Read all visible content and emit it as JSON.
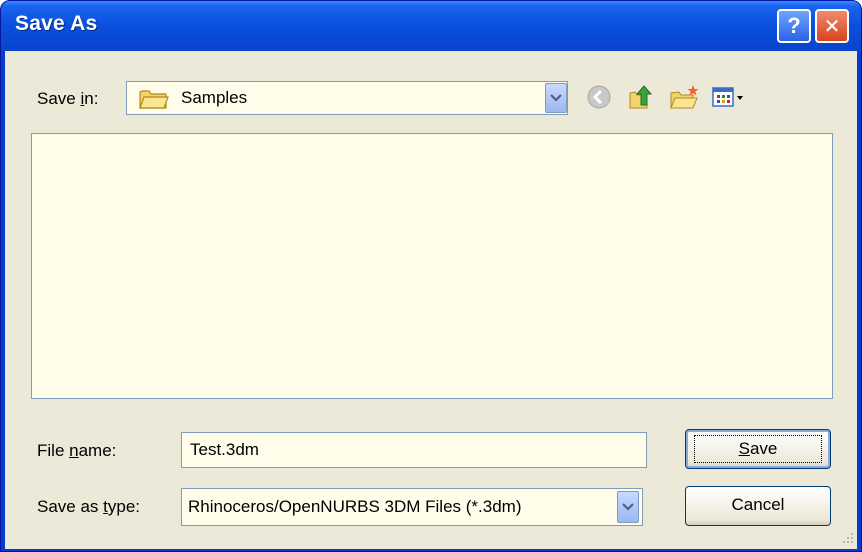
{
  "window": {
    "title": "Save As",
    "help_label": "?",
    "close_label": "✕"
  },
  "save_in": {
    "label_prefix": "Save ",
    "label_access": "i",
    "label_suffix": "n:",
    "value": "Samples"
  },
  "toolbar": {
    "icons": [
      "back-icon",
      "up-folder-icon",
      "new-folder-icon",
      "views-menu-icon"
    ]
  },
  "file_name": {
    "label_prefix": "File ",
    "label_access": "n",
    "label_suffix": "ame:",
    "value": "Test.3dm"
  },
  "save_type": {
    "label_prefix": "Save as ",
    "label_access": "t",
    "label_suffix": "ype:",
    "value": "Rhinoceros/OpenNURBS 3DM Files (*.3dm)"
  },
  "buttons": {
    "save_access": "S",
    "save_rest": "ave",
    "cancel": "Cancel"
  },
  "colors": {
    "titlebar": "#0a50dc",
    "client": "#ece9d8",
    "field_bg": "#fffdea",
    "close_button": "#d8431e"
  }
}
